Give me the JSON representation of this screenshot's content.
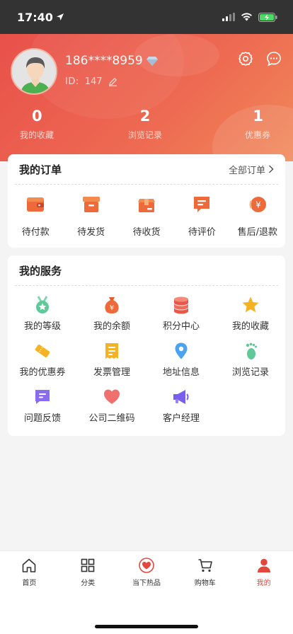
{
  "status": {
    "time": "17:40"
  },
  "user": {
    "phone": "186****8959",
    "id_label": "ID:",
    "id_value": "147"
  },
  "stats": [
    {
      "num": "0",
      "label": "我的收藏"
    },
    {
      "num": "2",
      "label": "浏览记录"
    },
    {
      "num": "1",
      "label": "优惠券"
    }
  ],
  "orders": {
    "title": "我的订单",
    "all_label": "全部订单",
    "items": [
      "待付款",
      "待发货",
      "待收货",
      "待评价",
      "售后/退款"
    ]
  },
  "services": {
    "title": "我的服务",
    "items": [
      "我的等级",
      "我的余额",
      "积分中心",
      "我的收藏",
      "我的优惠券",
      "发票管理",
      "地址信息",
      "浏览记录",
      "问题反馈",
      "公司二维码",
      "客户经理"
    ]
  },
  "tabbar": {
    "items": [
      "首页",
      "分类",
      "当下热品",
      "购物车",
      "我的"
    ],
    "active_color": "#e2483e"
  },
  "colors": {
    "brand": "#e8504a",
    "accent_orange": "#f0663d"
  },
  "icons": {
    "header": [
      "settings-icon",
      "message-icon"
    ],
    "orders": [
      "wallet-icon",
      "box-icon",
      "package-icon",
      "comment-icon",
      "refund-icon"
    ],
    "services": [
      "medal-icon",
      "money-bag-icon",
      "coin-stack-icon",
      "star-icon",
      "coupon-icon",
      "invoice-icon",
      "location-icon",
      "footprint-icon",
      "feedback-icon",
      "heart-icon",
      "megaphone-icon"
    ],
    "tabbar": [
      "home-icon",
      "grid-icon",
      "hot-heart-icon",
      "cart-icon",
      "person-icon"
    ]
  }
}
